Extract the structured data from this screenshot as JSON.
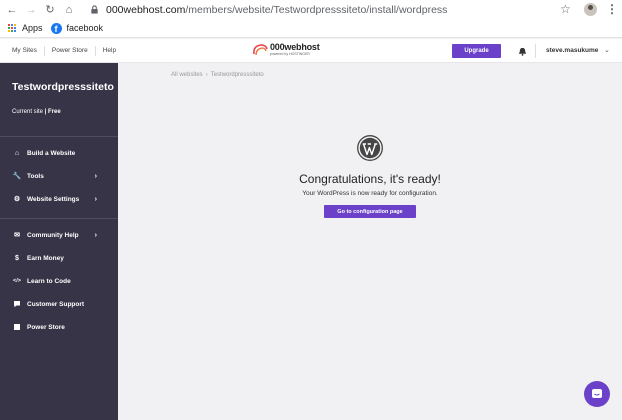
{
  "browser": {
    "url_host": "000webhost.com",
    "url_path": "/members/website/Testwordpresssiteto/install/wordpress",
    "bookmarks": [
      {
        "label": "Apps",
        "icon": "apps-grid-icon"
      },
      {
        "label": "facebook",
        "icon": "facebook-icon"
      }
    ]
  },
  "header": {
    "links": [
      "My Sites",
      "Power Store",
      "Help"
    ],
    "logo_main": "000webhost",
    "logo_sub": "powered by HOSTINGER",
    "upgrade_label": "Upgrade",
    "user_name": "steve.masukume"
  },
  "sidebar": {
    "site_title": "Testwordpresssiteto",
    "current_site": "Current site",
    "plan": "| Free",
    "items": [
      {
        "label": "Build a Website",
        "icon": "home-icon",
        "has_chevron": false
      },
      {
        "label": "Tools",
        "icon": "wrench-icon",
        "has_chevron": true
      },
      {
        "label": "Website Settings",
        "icon": "gear-icon",
        "has_chevron": true
      },
      {
        "label": "Community Help",
        "icon": "chat-bubbles-icon",
        "has_chevron": true
      },
      {
        "label": "Earn Money",
        "icon": "money-icon",
        "has_chevron": false
      },
      {
        "label": "Learn to Code",
        "icon": "code-icon",
        "has_chevron": false
      },
      {
        "label": "Customer Support",
        "icon": "speech-bubble-icon",
        "has_chevron": false
      },
      {
        "label": "Power Store",
        "icon": "store-icon",
        "has_chevron": false
      }
    ]
  },
  "main": {
    "breadcrumb_root": "All websites",
    "breadcrumb_separator": "›",
    "breadcrumb_current": "Testwordpresssiteto",
    "heading": "Congratulations, it's ready!",
    "subheading": "Your WordPress is now ready for configuration.",
    "config_button": "Go to configuration page"
  },
  "colors": {
    "accent": "#6b41c9",
    "sidebar_bg": "#363446",
    "content_bg": "#f1f1f3"
  }
}
